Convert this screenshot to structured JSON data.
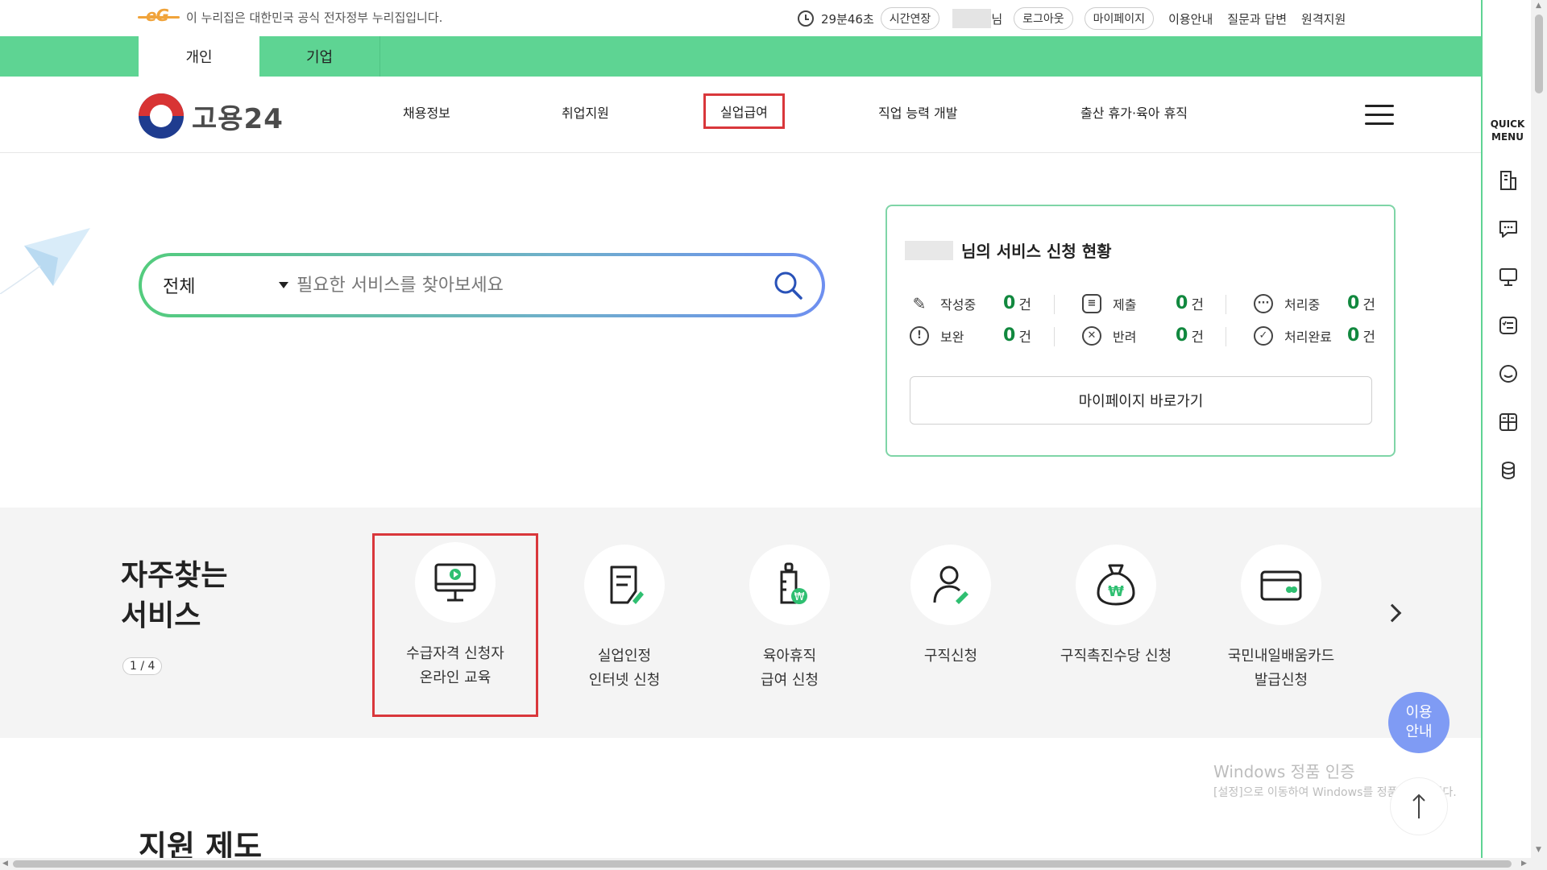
{
  "utilbar": {
    "notice": "이 누리집은 대한민국 공식 전자정부 누리집입니다.",
    "timer": "29분46초",
    "extend_label": "시간연장",
    "user_suffix": "님",
    "logout_label": "로그아웃",
    "mypage_label": "마이페이지",
    "links": [
      "이용안내",
      "질문과 답변",
      "원격지원"
    ]
  },
  "tabs": [
    "개인",
    "기업"
  ],
  "header": {
    "logo_text": "고용24",
    "nav": [
      "채용정보",
      "취업지원",
      "실업급여",
      "직업 능력 개발",
      "출산 휴가·육아 휴직"
    ]
  },
  "search": {
    "scope": "전체",
    "placeholder": "필요한 서비스를 찾아보세요",
    "value": ""
  },
  "status": {
    "title_suffix": "님의 서비스 신청 현황",
    "items": [
      {
        "label": "작성중",
        "count": "0",
        "unit": "건",
        "icon": "pencil-icon"
      },
      {
        "label": "제출",
        "count": "0",
        "unit": "건",
        "icon": "checklist-icon"
      },
      {
        "label": "처리중",
        "count": "0",
        "unit": "건",
        "icon": "more-icon"
      },
      {
        "label": "보완",
        "count": "0",
        "unit": "건",
        "icon": "exclamation-icon"
      },
      {
        "label": "반려",
        "count": "0",
        "unit": "건",
        "icon": "reject-icon"
      },
      {
        "label": "처리완료",
        "count": "0",
        "unit": "건",
        "icon": "check-icon"
      }
    ],
    "mypage_button": "마이페이지 바로가기"
  },
  "freq": {
    "title_line1": "자주찾는",
    "title_line2": "서비스",
    "page": "1 / 4",
    "services": [
      {
        "line1": "수급자격 신청자",
        "line2": "온라인 교육",
        "icon": "monitor-play-icon"
      },
      {
        "line1": "실업인정",
        "line2": "인터넷 신청",
        "icon": "document-edit-icon"
      },
      {
        "line1": "육아휴직",
        "line2": "급여 신청",
        "icon": "baby-bottle-icon"
      },
      {
        "line1": "구직신청",
        "line2": "",
        "icon": "person-edit-icon"
      },
      {
        "line1": "구직촉진수당 신청",
        "line2": "",
        "icon": "money-bag-icon"
      },
      {
        "line1": "국민내일배움카드",
        "line2": "발급신청",
        "icon": "card-icon"
      }
    ]
  },
  "help_button": {
    "line1": "이용",
    "line2": "안내"
  },
  "watermark": {
    "line1": "Windows 정품 인증",
    "line2": "[설정]으로 이동하여 Windows를 정품 인증합니다."
  },
  "section_title": "지원 제도",
  "quick_menu": {
    "label_line1": "QUICK",
    "label_line2": "MENU"
  },
  "colors": {
    "green": "#5ed493",
    "highlight": "#d9373b",
    "count": "#11883e",
    "help": "#7f9bf4"
  }
}
